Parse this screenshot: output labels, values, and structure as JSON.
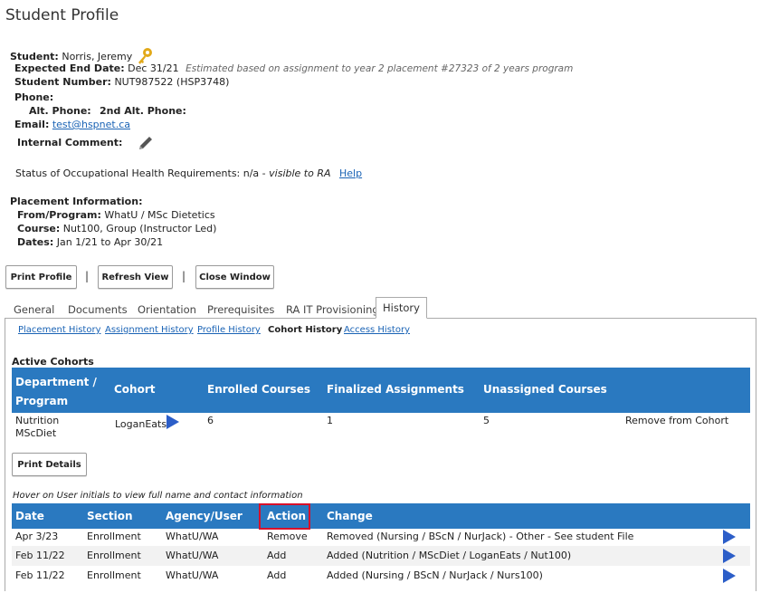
{
  "page_title": "Student Profile",
  "student": {
    "label": "Student:",
    "name": "Norris, Jeremy",
    "end_date_label": "Expected End Date:",
    "end_date": "Dec 31/21",
    "end_date_note": "Estimated based on assignment to year 2 placement #27323 of 2 years program",
    "number_label": "Student Number:",
    "number": "NUT987522  (HSP3748)",
    "phone_label": "Phone:",
    "alt_phone_label": "Alt. Phone:",
    "alt2_phone_label": "2nd Alt. Phone:",
    "email_label": "Email:",
    "email": "test@hspnet.ca",
    "comment_label": "Internal Comment:"
  },
  "ohr": {
    "text": "Status of Occupational Health Requirements: n/a - ",
    "visible_note": "visible to RA",
    "help": "Help"
  },
  "placement": {
    "heading": "Placement Information:",
    "from_label": "From/Program:",
    "from": "WhatU / MSc Dietetics",
    "course_label": "Course:",
    "course": "Nut100, Group (Instructor Led)",
    "dates_label": "Dates:",
    "dates": "Jan 1/21  to  Apr 30/21"
  },
  "toolbar": {
    "print_profile": "Print Profile",
    "sep": "|",
    "refresh_view": "Refresh View",
    "close_window": "Close Window"
  },
  "tabs": [
    "General",
    "Documents",
    "Orientation",
    "Prerequisites",
    "RA IT Provisioning",
    "History"
  ],
  "subtabs": [
    "Placement History",
    "Assignment History",
    "Profile History",
    "Cohort History",
    "Access History"
  ],
  "cohorts": {
    "heading": "Active Cohorts",
    "columns": [
      "Department / Program",
      "Cohort",
      "Enrolled Courses",
      "Finalized Assignments",
      "Unassigned Courses"
    ],
    "row": {
      "dept": "Nutrition MScDiet",
      "cohort": "LoganEats",
      "enrolled": "6",
      "finalized": "1",
      "unassigned": "5",
      "remove": "Remove from Cohort"
    },
    "print_details": "Print Details"
  },
  "history": {
    "hover_note": "Hover on User initials to view full name and contact information",
    "columns": [
      "Date",
      "Section",
      "Agency/User",
      "Action",
      "Change"
    ],
    "rows": [
      {
        "date": "Apr 3/23",
        "section": "Enrollment",
        "agency": "WhatU/WA",
        "action": "Remove",
        "change": "Removed (Nursing / BScN / NurJack) - Other - See student File"
      },
      {
        "date": "Feb 11/22",
        "section": "Enrollment",
        "agency": "WhatU/WA",
        "action": "Add",
        "change": "Added (Nutrition / MScDiet / LoganEats / Nut100)"
      },
      {
        "date": "Feb 11/22",
        "section": "Enrollment",
        "agency": "WhatU/WA",
        "action": "Add",
        "change": "Added (Nursing / BScN / NurJack / Nurs100)"
      }
    ]
  },
  "colors": {
    "header_blue": "#2a79c0",
    "link": "#1a63b5",
    "highlight": "#d8102a",
    "play_icon": "#2c5ec8"
  }
}
